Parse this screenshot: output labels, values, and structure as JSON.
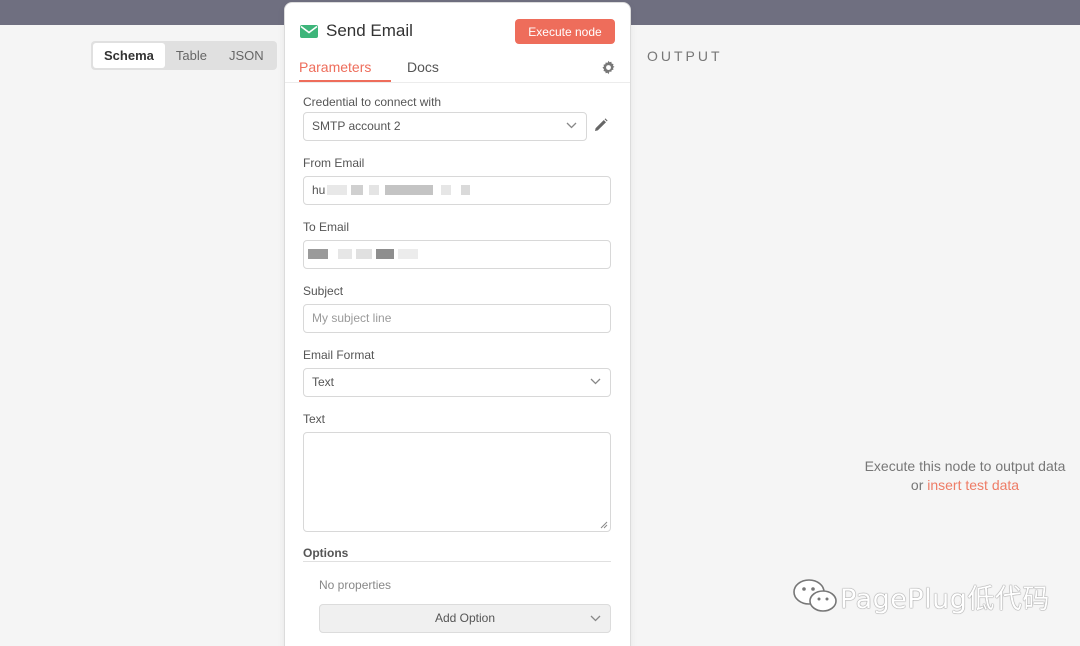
{
  "colors": {
    "accent": "#ee6d5b",
    "topbar": "#6f6f80",
    "link": "#ee7c66"
  },
  "input_tabs": [
    "Schema",
    "Table",
    "JSON"
  ],
  "output": {
    "label": "OUTPUT",
    "message": "Execute this node to output data",
    "or_text": "or",
    "link_text": "insert test data"
  },
  "node": {
    "icon": "envelope-icon",
    "title": "Send Email",
    "execute_label": "Execute node",
    "tabs": {
      "parameters": "Parameters",
      "docs": "Docs"
    }
  },
  "fields": {
    "credential": {
      "label": "Credential to connect with",
      "value": "SMTP account 2"
    },
    "from": {
      "label": "From Email",
      "value_prefix": "hu"
    },
    "to": {
      "label": "To Email"
    },
    "subject": {
      "label": "Subject",
      "placeholder": "My subject line"
    },
    "format": {
      "label": "Email Format",
      "value": "Text"
    },
    "text": {
      "label": "Text"
    }
  },
  "options": {
    "title": "Options",
    "empty": "No properties",
    "add_label": "Add Option"
  },
  "watermark": {
    "text": "PagePlug低代码",
    "icon": "wechat-icon"
  }
}
